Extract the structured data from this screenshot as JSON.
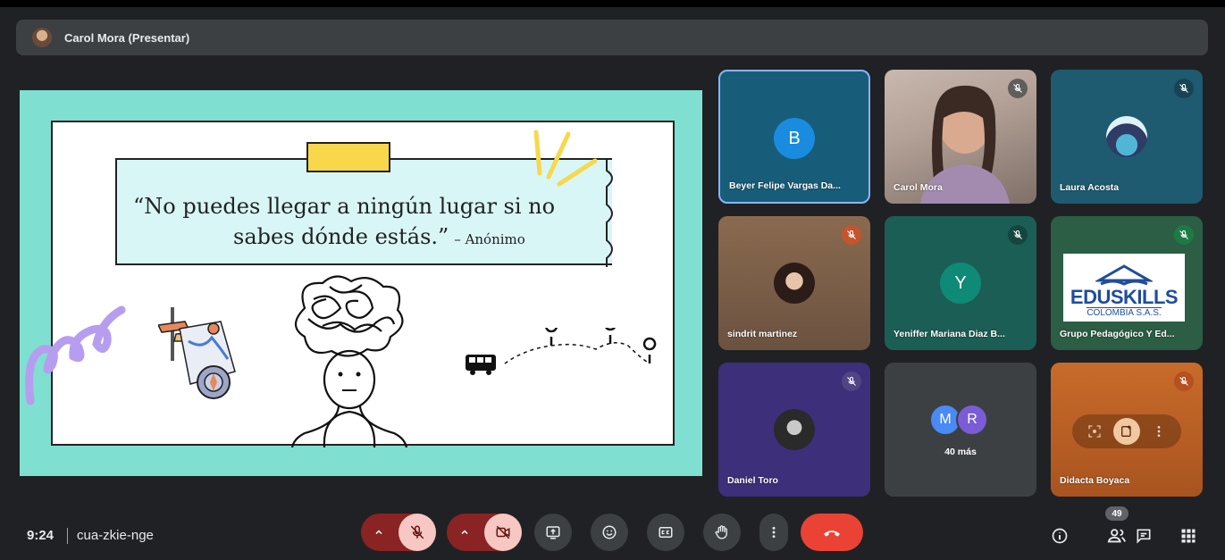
{
  "presenter": {
    "name": "Carol Mora (Presentar)"
  },
  "slide": {
    "quote_line1": "“No puedes llegar a ningún lugar si no",
    "quote_line2": "sabes dónde estás.”",
    "quote_author": "– Anónimo"
  },
  "participants": [
    {
      "name": "Beyer Felipe Vargas Da...",
      "avatar_letter": "B",
      "muted": false
    },
    {
      "name": "Carol Mora",
      "muted": true
    },
    {
      "name": "Laura Acosta",
      "muted": true
    },
    {
      "name": "sindrit martinez",
      "muted": true
    },
    {
      "name": "Yeniffer Mariana Diaz B...",
      "avatar_letter": "Y",
      "muted": true
    },
    {
      "name": "Grupo Pedagógico Y Ed...",
      "muted": true,
      "logo_line1": "EDUSKILLS",
      "logo_line2": "COLOMBIA S.A.S."
    },
    {
      "name": "Daniel Toro",
      "muted": true
    },
    {
      "name": "",
      "avatar_letters": [
        "M",
        "R"
      ],
      "more_label": "40 más"
    },
    {
      "name": "Didacta Boyaca",
      "muted": true
    }
  ],
  "bottom_bar": {
    "time": "9:24",
    "meeting_code": "cua-zkie-nge",
    "participant_count": "49"
  },
  "colors": {
    "background": "#202124",
    "end_call": "#ea4335",
    "muted_control": "#f6c7c3",
    "speaking_border": "#8ab4f8"
  },
  "icons": [
    "mic-off-icon",
    "video-off-icon",
    "present-icon",
    "emoji-icon",
    "captions-icon",
    "raise-hand-icon",
    "more-options-icon",
    "end-call-icon",
    "info-icon",
    "people-icon",
    "chat-icon",
    "activities-icon"
  ]
}
